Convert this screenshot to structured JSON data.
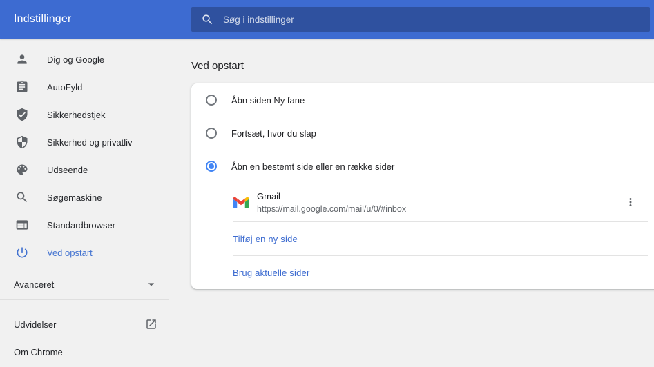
{
  "header": {
    "title": "Indstillinger",
    "search_placeholder": "Søg i indstillinger"
  },
  "colors": {
    "header_bg": "#3d6bd1",
    "search_field_bg": "#2f519f",
    "accent_blue": "#4285f4",
    "link_blue": "#3c6bd0",
    "icon_gray": "#5f6368",
    "page_bg": "#f1f1f1",
    "card_bg": "#ffffff"
  },
  "sidebar": {
    "items": [
      {
        "label": "Dig og Google",
        "icon": "person-icon",
        "selected": false
      },
      {
        "label": "AutoFyld",
        "icon": "autofill-icon",
        "selected": false
      },
      {
        "label": "Sikkerhedstjek",
        "icon": "safety-check-icon",
        "selected": false
      },
      {
        "label": "Sikkerhed og privatliv",
        "icon": "security-icon",
        "selected": false
      },
      {
        "label": "Udseende",
        "icon": "appearance-icon",
        "selected": false
      },
      {
        "label": "Søgemaskine",
        "icon": "search-engine-icon",
        "selected": false
      },
      {
        "label": "Standardbrowser",
        "icon": "default-browser-icon",
        "selected": false
      },
      {
        "label": "Ved opstart",
        "icon": "power-icon",
        "selected": true
      }
    ],
    "advanced_label": "Avanceret",
    "extensions_label": "Udvidelser",
    "about_label": "Om Chrome"
  },
  "main": {
    "section_title": "Ved opstart",
    "options": [
      {
        "label": "Åbn siden Ny fane",
        "selected": false
      },
      {
        "label": "Fortsæt, hvor du slap",
        "selected": false
      },
      {
        "label": "Åbn en bestemt side eller en række sider",
        "selected": true
      }
    ],
    "startup_page": {
      "name": "Gmail",
      "url": "https://mail.google.com/mail/u/0/#inbox"
    },
    "add_page_label": "Tilføj en ny side",
    "use_current_label": "Brug aktuelle sider"
  }
}
